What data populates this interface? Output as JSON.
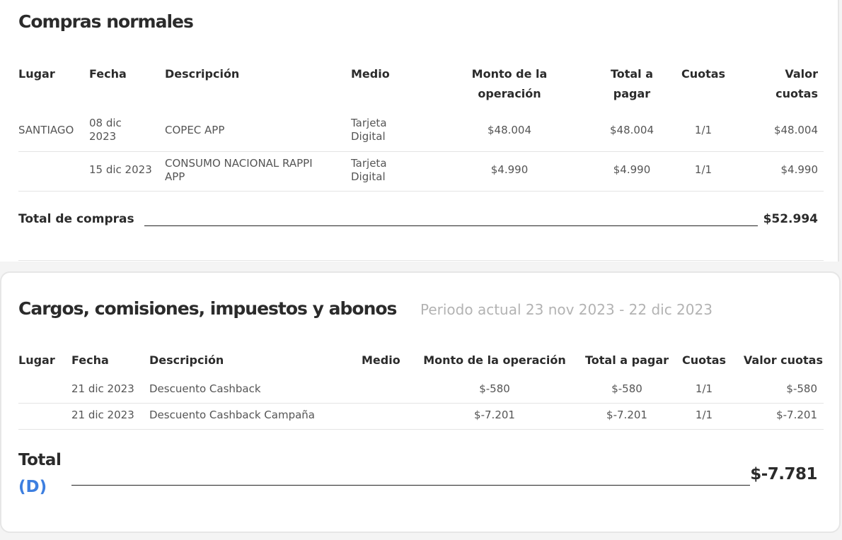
{
  "section1": {
    "title": "Compras normales",
    "headers": {
      "lugar": "Lugar",
      "fecha": "Fecha",
      "descripcion": "Descripción",
      "medio": "Medio",
      "monto_l1": "Monto de la",
      "monto_l2": "operación",
      "total_l1": "Total a",
      "total_l2": "pagar",
      "cuotas": "Cuotas",
      "valor_l1": "Valor",
      "valor_l2": "cuotas"
    },
    "rows": [
      {
        "lugar": "SANTIAGO",
        "fecha_l1": "08 dic",
        "fecha_l2": "2023",
        "descripcion_l1": "COPEC APP",
        "descripcion_l2": "",
        "medio_l1": "Tarjeta",
        "medio_l2": "Digital",
        "monto": "$48.004",
        "total": "$48.004",
        "cuotas": "1/1",
        "valor": "$48.004"
      },
      {
        "lugar": "",
        "fecha_l1": "15 dic 2023",
        "fecha_l2": "",
        "descripcion_l1": "CONSUMO NACIONAL RAPPI",
        "descripcion_l2": "APP",
        "medio_l1": "Tarjeta",
        "medio_l2": "Digital",
        "monto": "$4.990",
        "total": "$4.990",
        "cuotas": "1/1",
        "valor": "$4.990"
      }
    ],
    "total_label": "Total de compras",
    "total_value": "$52.994"
  },
  "section2": {
    "title": "Cargos, comisiones, impuestos y abonos",
    "period": "Periodo actual 23 nov 2023 - 22 dic 2023",
    "headers": {
      "lugar": "Lugar",
      "fecha": "Fecha",
      "descripcion": "Descripción",
      "medio": "Medio",
      "monto": "Monto de la operación",
      "total": "Total a pagar",
      "cuotas": "Cuotas",
      "valor": "Valor cuotas"
    },
    "rows": [
      {
        "fecha": "21 dic 2023",
        "descripcion": "Descuento Cashback",
        "monto": "$-580",
        "total": "$-580",
        "cuotas": "1/1",
        "valor": "$-580"
      },
      {
        "fecha": "21 dic 2023",
        "descripcion": "Descuento Cashback Campaña",
        "monto": "$-7.201",
        "total": "$-7.201",
        "cuotas": "1/1",
        "valor": "$-7.201"
      }
    ],
    "total_label": "Total",
    "total_marker": "(D)",
    "total_value": "$-7.781"
  }
}
